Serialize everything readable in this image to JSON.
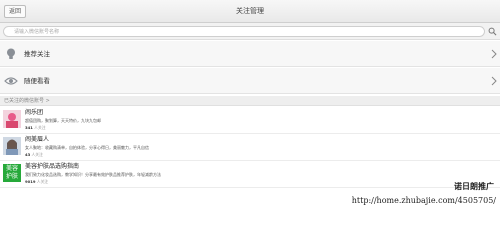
{
  "header": {
    "back_label": "返回",
    "title": "关注管理"
  },
  "search": {
    "placeholder": "请输入微信账号名称",
    "icon": "search-icon"
  },
  "menu": [
    {
      "label": "推荐关注",
      "icon": "lightbulb-icon"
    },
    {
      "label": "随便看看",
      "icon": "eye-icon"
    }
  ],
  "section": {
    "label": "已关注的微信账号"
  },
  "accounts": [
    {
      "name": "闹乐团",
      "desc": "超值团购，聚划算，天天特价，九块九包邮",
      "count": "341",
      "count_suffix": "人关注"
    },
    {
      "name": "闹美眉人",
      "desc": "女人聚地：收藏购清单，自拍体验，分享心得日，美丽魅力，平凡自信",
      "count": "43",
      "count_suffix": "人关注"
    },
    {
      "name": "美容护肤品选购指南",
      "desc": "我们致力化妆品选购，教学知识！分享最有效护肤品推荐护肤，年轻减龄方法",
      "count": "9019",
      "count_suffix": "人关注",
      "thumb_text": [
        "美容",
        "护肤"
      ]
    }
  ],
  "watermark": {
    "line1": "诺日朗推广",
    "line2": "http://home.zhubajie.com/4505705/"
  },
  "colors": {
    "accent_green": "#26a93a",
    "thumb_pink": "#e85a8a",
    "thumb_skin": "#e9c9b3"
  }
}
